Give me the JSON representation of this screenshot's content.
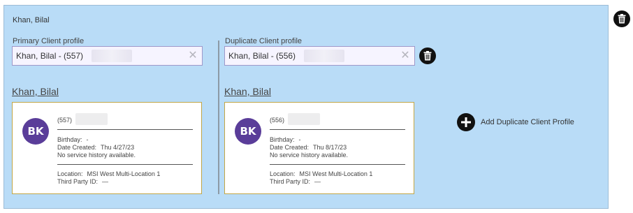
{
  "panel": {
    "title": "Khan, Bilal"
  },
  "primary": {
    "field_label": "Primary Client profile",
    "select_value": "Khan, Bilal - (557)",
    "clear_glyph": "✕",
    "client_name": "Khan, Bilal",
    "card": {
      "initials": "BK",
      "id_prefix": "(557)",
      "birthday_label": "Birthday:",
      "birthday_value": "-",
      "date_created_label": "Date Created:",
      "date_created_value": "Thu 4/27/23",
      "service_history": "No service history available.",
      "location_label": "Location:",
      "location_value": "MSI West Multi-Location 1",
      "third_party_label": "Third Party ID:",
      "third_party_value": "—"
    }
  },
  "duplicate": {
    "field_label": "Duplicate Client profile",
    "select_value": "Khan, Bilal - (556)",
    "clear_glyph": "✕",
    "client_name": "Khan, Bilal",
    "card": {
      "initials": "BK",
      "id_prefix": "(556)",
      "birthday_label": "Birthday:",
      "birthday_value": "-",
      "date_created_label": "Date Created:",
      "date_created_value": "Thu 8/17/23",
      "service_history": "No service history available.",
      "location_label": "Location:",
      "location_value": "MSI West Multi-Location 1",
      "third_party_label": "Third Party ID:",
      "third_party_value": "—"
    }
  },
  "actions": {
    "add_duplicate_label": "Add Duplicate Client Profile"
  },
  "icons": {
    "trash": "trash-icon",
    "add": "plus-circle-icon",
    "clear": "close-icon"
  },
  "colors": {
    "panel_bg": "#b9dcf7",
    "avatar_bg": "#5a3d99",
    "card_border": "#c2a646"
  }
}
